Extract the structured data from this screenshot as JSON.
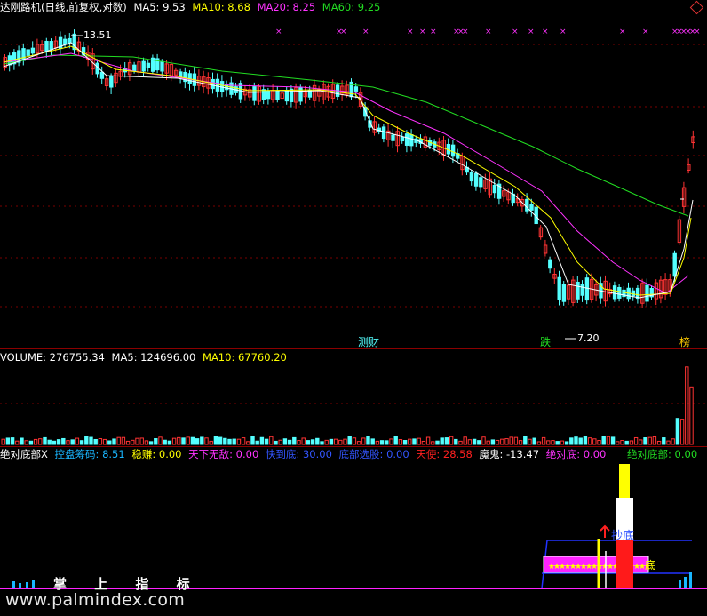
{
  "header": {
    "title": "达刚路机(日线,前复权,对数)",
    "ma5": "MA5: 9.53",
    "ma10": "MA10: 8.68",
    "ma20": "MA20: 8.25",
    "ma60": "MA60: 9.25"
  },
  "price_chart": {
    "high_label": "13.51",
    "low_label": "7.20",
    "tags": [
      "测财",
      "跌",
      "榜"
    ]
  },
  "volume": {
    "label": "VOLUME: 276755.34",
    "ma5": "MA5: 124696.00",
    "ma10": "MA10: 67760.20"
  },
  "indicator": {
    "name": "绝对底部X",
    "items": [
      {
        "label": "控盘筹码: 8.51",
        "color": "#19b6ff"
      },
      {
        "label": "稳赚: 0.00",
        "color": "#ffff00"
      },
      {
        "label": "天下无敌: 0.00",
        "color": "#ff33ff"
      },
      {
        "label": "快到底: 30.00",
        "color": "#3355ff"
      },
      {
        "label": "底部选股: 0.00",
        "color": "#3355ff"
      },
      {
        "label": "天使: 28.58",
        "color": "#ff2020"
      },
      {
        "label": "魔鬼: -13.47",
        "color": "#ffffff"
      },
      {
        "label": "绝对底: 0.00",
        "color": "#ff33ff"
      },
      {
        "label": "绝对底部: 0.00",
        "color": "#22dd22"
      }
    ],
    "chaodi": "抄底",
    "jd": "底",
    "zhang": "掌 上 指 标"
  },
  "watermark": "www.palmindex.com",
  "colors": {
    "up": "#ff3333",
    "down": "#54ffff",
    "ma5": "#ffffff",
    "ma10": "#ffff00",
    "ma20": "#ff33ff",
    "ma60": "#22dd22",
    "grid": "#7a0000"
  }
}
